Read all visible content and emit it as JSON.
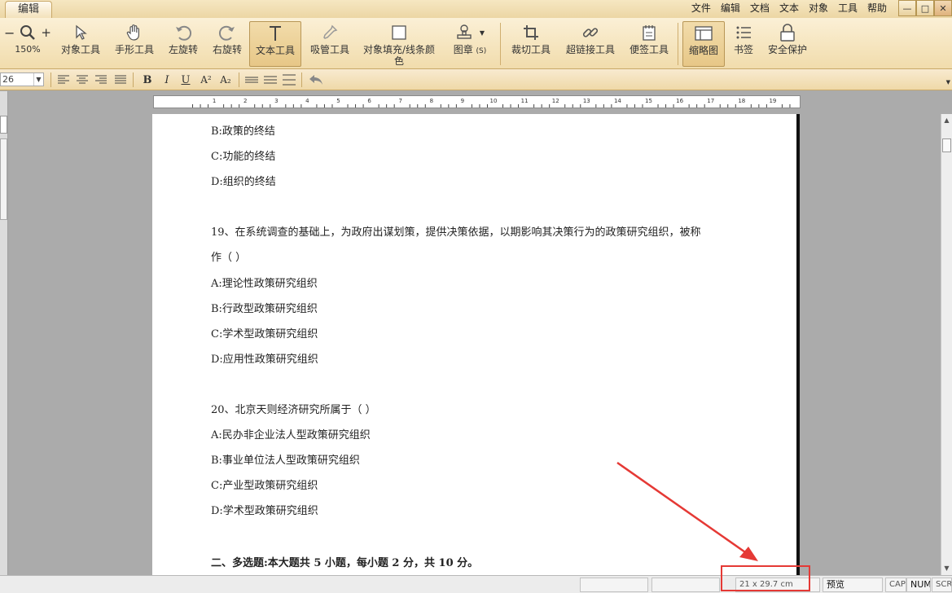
{
  "app": {
    "tab_label": "编辑",
    "menu": [
      "文件",
      "编辑",
      "文档",
      "文本",
      "对象",
      "工具",
      "帮助"
    ],
    "window_buttons": {
      "minimize": "—",
      "maximize": "□",
      "close": "✕"
    }
  },
  "ribbon": {
    "zoom": {
      "minus": "−",
      "plus": "+",
      "value": "150%"
    },
    "tools": {
      "object_tool": "对象工具",
      "hand_tool": "手形工具",
      "rotate_left": "左旋转",
      "rotate_right": "右旋转",
      "text_tool": "文本工具",
      "eyedropper_tool": "吸管工具",
      "fill_tool_line1": "对象填充/线条颜",
      "fill_tool_line2": "色",
      "stamp": "图章",
      "stamp_shortcut": "(S)",
      "crop_tool": "裁切工具",
      "link_tool": "超链接工具",
      "note_tool": "便签工具",
      "thumbnails": "缩略图",
      "bookmarks": "书签",
      "security": "安全保护"
    }
  },
  "format_bar": {
    "font_size": "26",
    "bold": "B",
    "italic": "I",
    "underline": "U",
    "superscript": "A²",
    "subscript": "A₂"
  },
  "ruler": {
    "labels": [
      "1",
      "2",
      "3",
      "4",
      "5",
      "6",
      "7",
      "8",
      "9",
      "10",
      "11",
      "12",
      "13",
      "14",
      "15",
      "16",
      "17",
      "18",
      "19",
      "20"
    ]
  },
  "document": {
    "lines": [
      "B:政策的终结",
      "C:功能的终结",
      "D:组织的终结",
      "19、在系统调查的基础上，为政府出谋划策，提供决策依据，以期影响其决策行为的政策研究组织，被称",
      "作（ ）",
      "A:理论性政策研究组织",
      "B:行政型政策研究组织",
      "C:学术型政策研究组织",
      "D:应用性政策研究组织",
      "20、北京天则经济研究所属于（ ）",
      "A:民办非企业法人型政策研究组织",
      "B:事业单位法人型政策研究组织",
      "C:产业型政策研究组织",
      "D:学术型政策研究组织",
      "二、多选题:本大题共 5 小题，每小题 2 分，共 10 分。"
    ]
  },
  "status": {
    "page_size": "21 x 29.7 cm",
    "mode": "预览",
    "cap": "CAP",
    "num": "NUM",
    "scrl": "SCRL"
  },
  "colors": {
    "ribbon": "#f1dcac",
    "highlight": "#e53935",
    "page": "#ffffff",
    "workspace": "#ababab"
  }
}
